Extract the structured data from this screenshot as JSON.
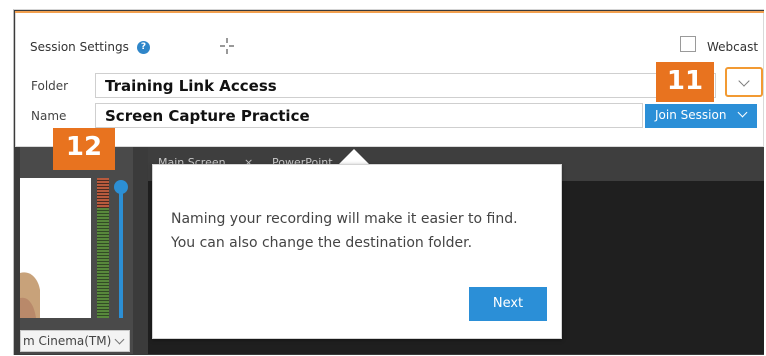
{
  "session": {
    "title": "Session Settings",
    "help_icon": "?",
    "webcast_label": "Webcast",
    "folder_label": "Folder",
    "folder_value": "Training Link Access",
    "name_label": "Name",
    "name_value": "Screen Capture Practice",
    "join_label": "Join Session"
  },
  "badges": {
    "b11": "11",
    "b12": "12"
  },
  "tabs": {
    "main": "Main Screen",
    "main_close": "×",
    "ppt": "PowerPoint"
  },
  "source": {
    "value": "m Cinema(TM)"
  },
  "popup": {
    "line1": "Naming your recording will make it easier to find.",
    "line2": "You can also change the destination folder.",
    "next_label": "Next"
  },
  "colors": {
    "accent": "#2b8fd7",
    "badge": "#e8731f",
    "highlight": "#f29a32"
  }
}
